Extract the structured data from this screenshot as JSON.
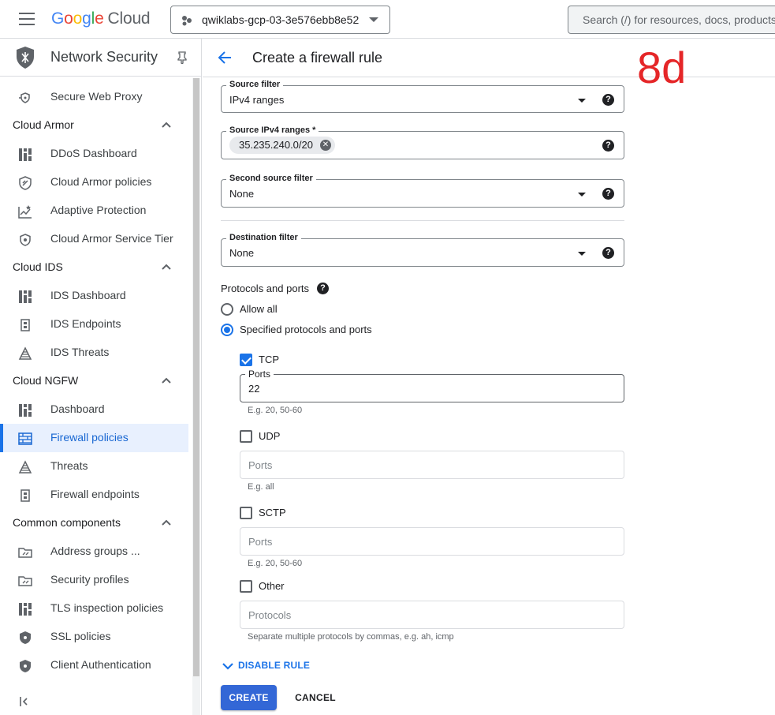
{
  "topbar": {
    "logo_letters": [
      "G",
      "o",
      "o",
      "g",
      "l",
      "e"
    ],
    "logo_cloud": "Cloud",
    "project_name": "qwiklabs-gcp-03-3e576ebb8e52",
    "search_placeholder": "Search (/) for resources, docs, products"
  },
  "sidebar": {
    "title": "Network Security",
    "items": {
      "secure_web_proxy": "Secure Web Proxy",
      "cloud_armor": "Cloud Armor",
      "ddos_dashboard": "DDoS Dashboard",
      "cloud_armor_policies": "Cloud Armor policies",
      "adaptive_protection": "Adaptive Protection",
      "cloud_armor_service_tier": "Cloud Armor Service Tier",
      "cloud_ids": "Cloud IDS",
      "ids_dashboard": "IDS Dashboard",
      "ids_endpoints": "IDS Endpoints",
      "ids_threats": "IDS Threats",
      "cloud_ngfw": "Cloud NGFW",
      "dashboard": "Dashboard",
      "firewall_policies": "Firewall policies",
      "threats": "Threats",
      "firewall_endpoints": "Firewall endpoints",
      "common_components": "Common components",
      "address_groups": "Address groups ...",
      "security_profiles": "Security profiles",
      "tls_inspection_policies": "TLS inspection policies",
      "ssl_policies": "SSL policies",
      "client_authentication": "Client Authentication"
    },
    "active_item": "Firewall policies"
  },
  "main": {
    "page_title": "Create a firewall rule",
    "annotation": "8d",
    "source_filter": {
      "label": "Source filter",
      "value": "IPv4 ranges"
    },
    "source_ipv4": {
      "label": "Source IPv4 ranges *",
      "chip": "35.235.240.0/20"
    },
    "second_source_filter": {
      "label": "Second source filter",
      "value": "None"
    },
    "destination_filter": {
      "label": "Destination filter",
      "value": "None"
    },
    "protocols": {
      "label": "Protocols and ports",
      "allow_all": "Allow all",
      "specified": "Specified protocols and ports",
      "selected": "Specified protocols and ports",
      "tcp": {
        "label": "TCP",
        "checked": true,
        "ports_label": "Ports",
        "ports_value": "22",
        "hint": "E.g. 20, 50-60"
      },
      "udp": {
        "label": "UDP",
        "checked": false,
        "placeholder": "Ports",
        "hint": "E.g. all"
      },
      "sctp": {
        "label": "SCTP",
        "checked": false,
        "placeholder": "Ports",
        "hint": "E.g. 20, 50-60"
      },
      "other": {
        "label": "Other",
        "checked": false,
        "placeholder": "Protocols",
        "hint": "Separate multiple protocols by commas, e.g. ah, icmp"
      }
    },
    "disable_rule": "DISABLE RULE",
    "create_button": "CREATE",
    "cancel_button": "CANCEL"
  },
  "colors": {
    "accent": "#1a73e8",
    "create_button": "#3367d6",
    "annotation": "#e52628",
    "active_nav_bg": "#e8f0fe"
  }
}
